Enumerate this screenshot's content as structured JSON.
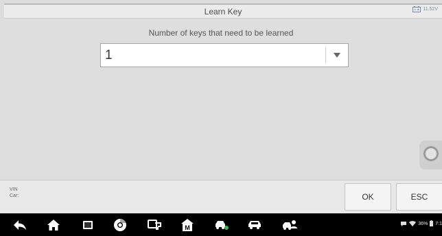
{
  "titlebar": {
    "title": "Learn Key",
    "battery_voltage": "11.52V"
  },
  "dialog": {
    "question": "Number of keys that need to be learned",
    "selected_value": "1"
  },
  "vehicle_info": {
    "vin_label": "VIN",
    "car_label": "Car:"
  },
  "buttons": {
    "ok_label": "OK",
    "esc_label": "ESC"
  },
  "navbar": {
    "icons": [
      "back-icon",
      "home-icon",
      "recent-apps-icon",
      "chrome-icon",
      "remote-desk-icon",
      "maxifix-icon",
      "car-service-icon",
      "car-icon",
      "car-user-icon"
    ]
  },
  "status_bar": {
    "battery_percent": "36%",
    "time": "7:1"
  },
  "colors": {
    "background": "#dcdcdc",
    "titlebar": "#ececec",
    "navbar": "#000000",
    "status_icon": "#7a8aa0"
  }
}
